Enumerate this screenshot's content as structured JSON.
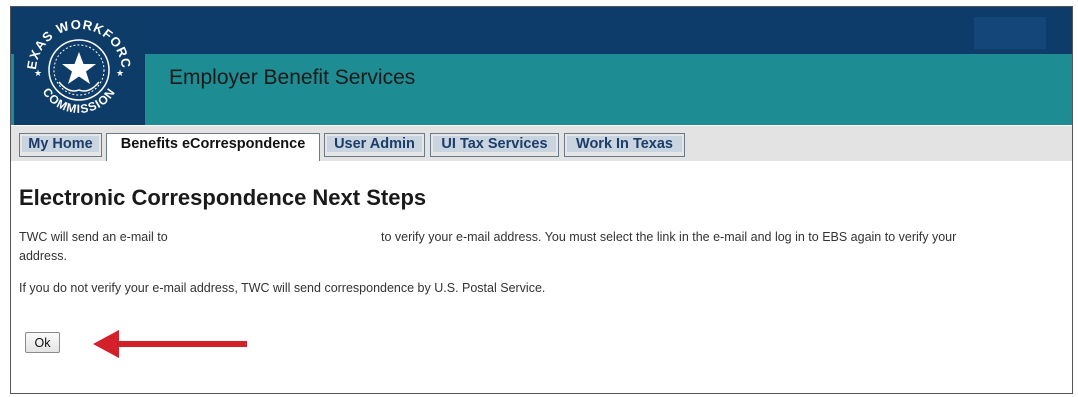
{
  "header": {
    "app_title": "Employer Benefit Services",
    "logo_text_top": "TEXAS WORKFORCE",
    "logo_text_bottom": "COMMISSION",
    "colors": {
      "navy": "#0d3c6a",
      "teal": "#1d8c93"
    }
  },
  "tabs": [
    {
      "label": "My Home",
      "active": false
    },
    {
      "label": "Benefits eCorrespondence",
      "active": true
    },
    {
      "label": "User Admin",
      "active": false
    },
    {
      "label": "UI Tax Services",
      "active": false
    },
    {
      "label": "Work In Texas",
      "active": false
    }
  ],
  "main": {
    "title": "Electronic Correspondence Next Steps",
    "para1_part1": "TWC will send an e-mail to",
    "para1_part2": "to verify your e-mail address. You must select the link in the e-mail and log in to EBS again to verify your",
    "para1_part3": "address.",
    "para2": "If you do not verify your e-mail address, TWC will send correspondence by U.S. Postal Service.",
    "ok_label": "Ok"
  },
  "annotation": {
    "arrow_color": "#d3202a",
    "icon": "left-arrow-icon"
  }
}
